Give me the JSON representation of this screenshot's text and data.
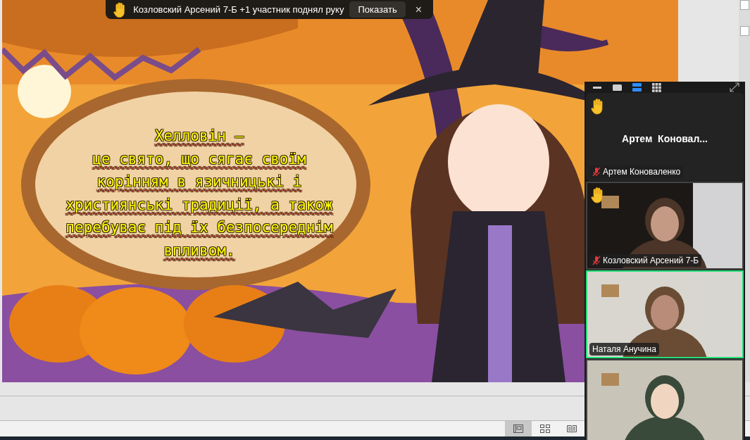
{
  "notification": {
    "text": "Козловский Арсений 7-Б +1 участник поднял руку",
    "action": "Показать",
    "close": "×"
  },
  "slide": {
    "lines": [
      "Хелловін –",
      "це свято, що сягає своїм",
      "корінням в язичницькі і",
      "християнські традиції, а також",
      "перебуває під їх безпосереднім",
      "впливом."
    ]
  },
  "status_bar": {
    "views": [
      {
        "kind": "normal",
        "selected": true
      },
      {
        "kind": "sorter",
        "selected": false
      },
      {
        "kind": "reading",
        "selected": false
      }
    ]
  },
  "video_panel": {
    "view_modes": [
      {
        "kind": "minimize",
        "selected": false
      },
      {
        "kind": "thumbnail",
        "selected": false
      },
      {
        "kind": "strip",
        "selected": true
      },
      {
        "kind": "gallery",
        "selected": false
      }
    ],
    "participants": [
      {
        "kind": "avatar",
        "title": "Артем  Коновал...",
        "name": "Артем Коноваленко",
        "hand_raised": true,
        "muted": true,
        "active_speaker": false
      },
      {
        "kind": "video",
        "name": "Козловский Арсений 7-Б",
        "hand_raised": true,
        "muted": true,
        "active_speaker": false
      },
      {
        "kind": "video",
        "name": "Наталя Анучина",
        "hand_raised": false,
        "muted": false,
        "active_speaker": true
      },
      {
        "kind": "video",
        "hand_raised": false,
        "muted": false,
        "active_speaker": false
      }
    ]
  }
}
